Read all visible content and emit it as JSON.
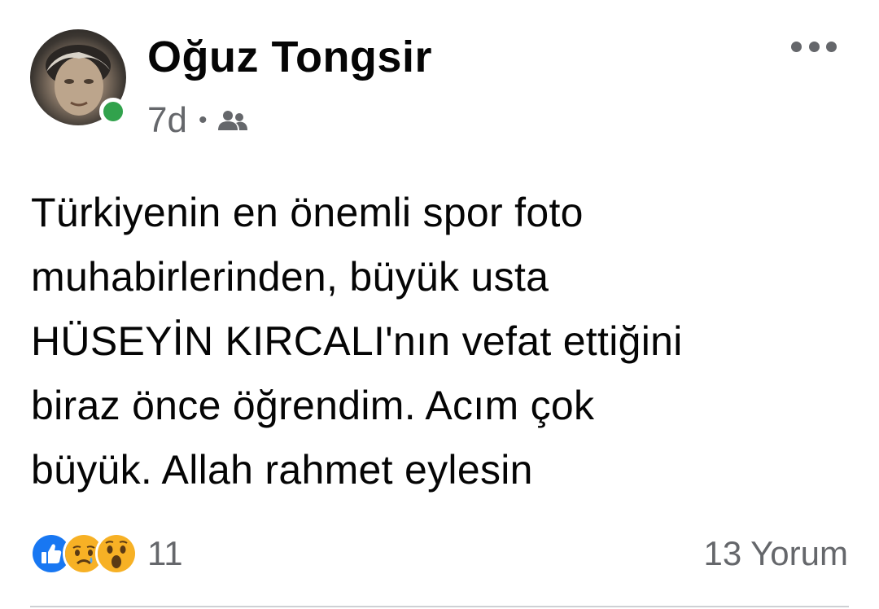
{
  "post": {
    "author": {
      "name": "Oğuz Tongsir",
      "online": true
    },
    "time": "7d",
    "separator": "•",
    "audience_icon": "friends-icon",
    "more_icon": "more-horizontal-icon",
    "text": "Türkiyenin en önemli spor foto\nmuhabirlerinden, büyük usta\nHÜSEYİN KIRCALI'nın vefat ettiğini\nbiraz önce öğrendim. Acım çok\nbüyük. Allah rahmet eylesin",
    "reactions": {
      "icons": [
        "like-reaction-icon",
        "sad-reaction-icon",
        "wow-reaction-icon"
      ],
      "count": "11"
    },
    "comments": "13 Yorum"
  },
  "colors": {
    "online": "#31a24c",
    "like": "#1877f2",
    "emoji": "#f7b125",
    "secondary_text": "#65676b"
  }
}
